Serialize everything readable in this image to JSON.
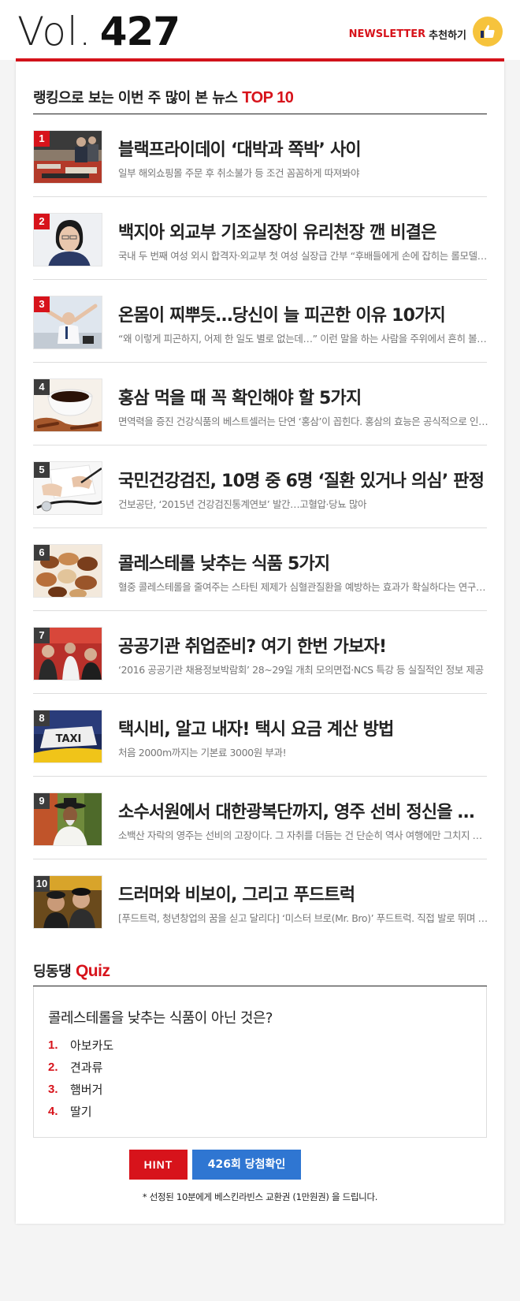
{
  "header": {
    "vol_prefix": "Vol.",
    "vol_number": "427",
    "newsletter_brand": "NEWSLETTER",
    "newsletter_action": "추천하기",
    "accent_color": "#d7131b"
  },
  "top10": {
    "title_prefix": "랭킹으로 보는 이번 주 많이 본 뉴스",
    "title_accent": "TOP 10",
    "items": [
      {
        "rank": "1",
        "title": "블랙프라이데이 ‘대박과 쪽박’ 사이",
        "desc": "일부 해외쇼핑몰 주문 후 취소불가 등 조건 꼼꼼하게 따져봐야",
        "image": "shoppers-photo"
      },
      {
        "rank": "2",
        "title": "백지아 외교부 기조실장이 유리천장 깬 비결은",
        "desc": "국내 두 번째 여성 외시 합격자·외교부 첫 여성 실장급 간부 “후배들에게 손에 잡히는 롤모델 되고 싶어”",
        "image": "portrait-photo"
      },
      {
        "rank": "3",
        "title": "온몸이 찌뿌듯…당신이 늘 피곤한 이유 10가지",
        "desc": "“왜 이렇게 피곤하지, 어제 한 일도 별로 없는데…” 이런 말을 하는 사람을 주위에서 흔히 볼 수 있다",
        "image": "stretching-man-photo"
      },
      {
        "rank": "4",
        "title": "홍삼 먹을 때 꼭 확인해야 할 5가지",
        "desc": "면역력을 증진 건강식품의 베스트셀러는 단연 ‘홍삼’이 꼽힌다. 홍삼의 효능은 공식적으로 인정받았다",
        "image": "red-ginseng-photo"
      },
      {
        "rank": "5",
        "title": "국민건강검진, 10명 중 6명 ‘질환 있거나 의심’ 판정",
        "desc": "건보공단, ‘2015년 건강검진통계연보’ 발간…고혈압·당뇨 많아",
        "image": "stethoscope-photo"
      },
      {
        "rank": "6",
        "title": "콜레스테롤 낮추는 식품 5가지",
        "desc": "혈중 콜레스테롤을 줄여주는 스타틴 제제가 심혈관질환을 예방하는 효과가 확실하다는 연구 결과",
        "image": "nuts-photo"
      },
      {
        "rank": "7",
        "title": "공공기관 취업준비? 여기 한번 가보자!",
        "desc": "‘2016 공공기관 채용정보박람회’ 28~29일 개최 모의면접·NCS 특강 등 실질적인 정보 제공",
        "image": "job-fair-photo"
      },
      {
        "rank": "8",
        "title": "택시비, 알고 내자! 택시 요금 계산 방법",
        "desc": "처음 2000m까지는 기본료 3000원 부과!",
        "image": "taxi-sign-photo"
      },
      {
        "rank": "9",
        "title": "소수서원에서 대한광복단까지, 영주 선비 정신을 찾아서",
        "desc": "소백산 자락의 영주는 선비의 고장이다. 그 자취를 더듬는 건 단순히 역사 여행에만 그치지 않는다",
        "image": "scholar-photo"
      },
      {
        "rank": "10",
        "title": "드러머와 비보이, 그리고 푸드트럭",
        "desc": "[푸드트럭, 청년창업의 꿈을 싣고 달리다] ‘미스터 브로(Mr. Bro)’ 푸드트럭. 직접 발로 뛰며 장사하는 청년들",
        "image": "food-truck-duo-photo"
      }
    ]
  },
  "quiz": {
    "title_prefix": "딩동댕",
    "title_accent": "Quiz",
    "question": "콜레스테롤을 낮추는 식품이 아닌 것은?",
    "options": [
      {
        "num": "1.",
        "text": "아보카도"
      },
      {
        "num": "2.",
        "text": "견과류"
      },
      {
        "num": "3.",
        "text": "햄버거"
      },
      {
        "num": "4.",
        "text": "딸기"
      }
    ],
    "hint_label": "HINT",
    "check_label": "426회 당첨확인",
    "note": "* 선정된 10분에게 베스킨라빈스 교환권 (1만원권) 을 드립니다."
  }
}
